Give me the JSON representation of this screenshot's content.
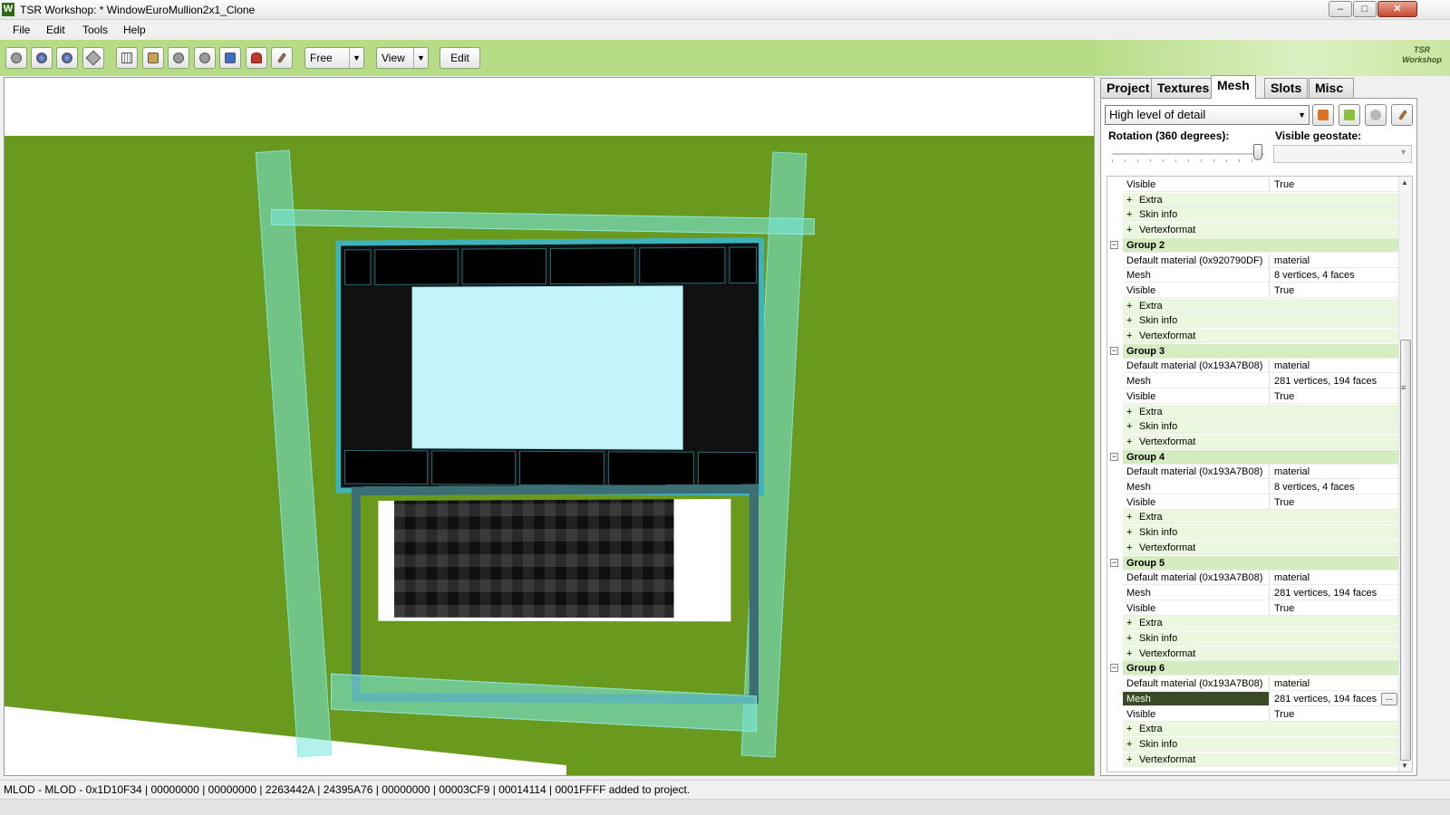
{
  "window": {
    "title": "TSR Workshop: * WindowEuroMullion2x1_Clone",
    "app_icon_letter": "W",
    "controls": {
      "minimize": "‒",
      "maximize": "□",
      "close": "✕"
    }
  },
  "menu": [
    "File",
    "Edit",
    "Tools",
    "Help"
  ],
  "toolbar": {
    "mode_select": "Free",
    "view_select": "View",
    "edit_button": "Edit",
    "icons": [
      "sphere-gray-icon",
      "sphere-dark-icon",
      "sphere-shaded-icon",
      "diamond-icon",
      "grid-icon",
      "texture-icon",
      "shadow-icon",
      "bump-icon",
      "bone-icon",
      "slot-icon",
      "brush-icon"
    ]
  },
  "brand": {
    "line1": "TSR",
    "line2": "Workshop"
  },
  "panel": {
    "tabs": [
      {
        "label": "Project",
        "active": false
      },
      {
        "label": "Textures",
        "active": false
      },
      {
        "label": "Mesh",
        "active": true
      },
      {
        "label": "Slots",
        "active": false
      },
      {
        "label": "Misc",
        "active": false
      }
    ],
    "lod_select": "High level of detail",
    "rotation_label": "Rotation (360 degrees):",
    "rotation_value": 1.0,
    "geostate_label": "Visible geostate:",
    "geostate_value": "",
    "rows": [
      {
        "type": "prop",
        "name": "Visible",
        "value": "True"
      },
      {
        "type": "sub",
        "name": "Extra"
      },
      {
        "type": "sub",
        "name": "Skin info"
      },
      {
        "type": "sub",
        "name": "Vertexformat"
      },
      {
        "type": "group",
        "name": "Group 2"
      },
      {
        "type": "prop",
        "name": "Default material (0x920790DF)",
        "value": "material"
      },
      {
        "type": "prop",
        "name": "Mesh",
        "value": "8 vertices, 4 faces"
      },
      {
        "type": "prop",
        "name": "Visible",
        "value": "True"
      },
      {
        "type": "sub",
        "name": "Extra"
      },
      {
        "type": "sub",
        "name": "Skin info"
      },
      {
        "type": "sub",
        "name": "Vertexformat"
      },
      {
        "type": "group",
        "name": "Group 3"
      },
      {
        "type": "prop",
        "name": "Default material (0x193A7B08)",
        "value": "material"
      },
      {
        "type": "prop",
        "name": "Mesh",
        "value": "281 vertices, 194 faces"
      },
      {
        "type": "prop",
        "name": "Visible",
        "value": "True"
      },
      {
        "type": "sub",
        "name": "Extra"
      },
      {
        "type": "sub",
        "name": "Skin info"
      },
      {
        "type": "sub",
        "name": "Vertexformat"
      },
      {
        "type": "group",
        "name": "Group 4"
      },
      {
        "type": "prop",
        "name": "Default material (0x193A7B08)",
        "value": "material"
      },
      {
        "type": "prop",
        "name": "Mesh",
        "value": "8 vertices, 4 faces"
      },
      {
        "type": "prop",
        "name": "Visible",
        "value": "True"
      },
      {
        "type": "sub",
        "name": "Extra"
      },
      {
        "type": "sub",
        "name": "Skin info"
      },
      {
        "type": "sub",
        "name": "Vertexformat"
      },
      {
        "type": "group",
        "name": "Group 5"
      },
      {
        "type": "prop",
        "name": "Default material (0x193A7B08)",
        "value": "material"
      },
      {
        "type": "prop",
        "name": "Mesh",
        "value": "281 vertices, 194 faces"
      },
      {
        "type": "prop",
        "name": "Visible",
        "value": "True"
      },
      {
        "type": "sub",
        "name": "Extra"
      },
      {
        "type": "sub",
        "name": "Skin info"
      },
      {
        "type": "sub",
        "name": "Vertexformat"
      },
      {
        "type": "group",
        "name": "Group 6"
      },
      {
        "type": "prop",
        "name": "Default material (0x193A7B08)",
        "value": "material"
      },
      {
        "type": "prop",
        "name": "Mesh",
        "value": "281 vertices, 194 faces",
        "selected": true,
        "ellipsis": "..."
      },
      {
        "type": "prop",
        "name": "Visible",
        "value": "True"
      },
      {
        "type": "sub",
        "name": "Extra"
      },
      {
        "type": "sub",
        "name": "Skin info"
      },
      {
        "type": "sub",
        "name": "Vertexformat"
      }
    ],
    "scroll_glyphs": {
      "up": "▲",
      "down": "▼",
      "grip": "≡"
    }
  },
  "status": "MLOD - MLOD - 0x1D10F34 | 00000000 | 00000000 | 2263442A | 24395A76 | 00000000 | 00003CF9 | 00014114 | 0001FFFF added to project.",
  "colors": {
    "accent_green": "#b6dc86",
    "viewport_ground": "#6a9a1d",
    "glass": "#c5f4fb",
    "selection": "#3a4a24"
  }
}
